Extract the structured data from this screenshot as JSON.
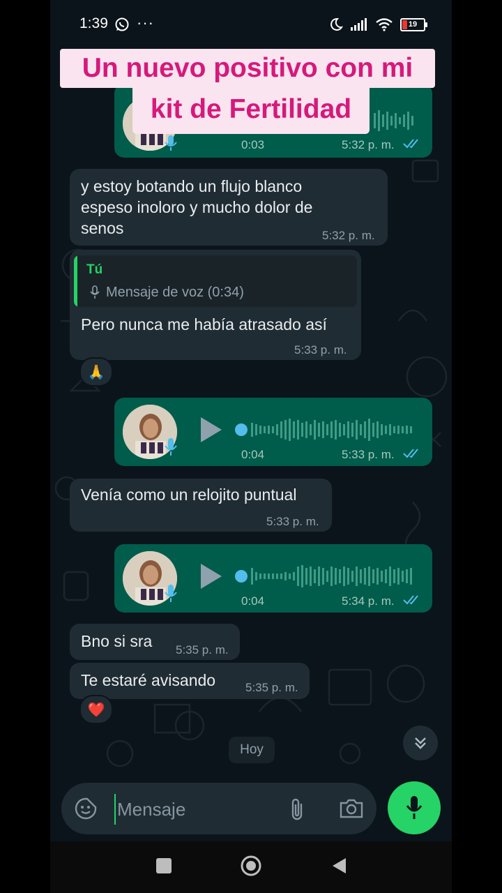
{
  "status_bar": {
    "time": "1:39",
    "more": "···",
    "battery": "19"
  },
  "overlay": {
    "line1": "Un nuevo positivo con mi",
    "line2": "kit de Fertilidad"
  },
  "messages": [
    {
      "type": "voice_out",
      "duration": "0:03",
      "time": "5:32 p. m."
    },
    {
      "type": "text_in",
      "text_line1": "y estoy botando un flujo blanco",
      "text_line2": "espeso inoloro y mucho dolor de",
      "text_line3": "senos",
      "time": "5:32 p. m."
    },
    {
      "type": "reply_in",
      "quote_author": "Tú",
      "quote_text": "Mensaje de voz (0:34)",
      "text": "Pero nunca me había atrasado así",
      "time": "5:33 p. m.",
      "reaction": "🙏"
    },
    {
      "type": "voice_out",
      "duration": "0:04",
      "time": "5:33 p. m."
    },
    {
      "type": "text_in",
      "text": "Venía como un relojito puntual",
      "time": "5:33 p. m."
    },
    {
      "type": "voice_out",
      "duration": "0:04",
      "time": "5:34 p. m."
    },
    {
      "type": "text_in",
      "text": "Bno si sra",
      "time": "5:35 p. m."
    },
    {
      "type": "text_in",
      "text": "Te estaré avisando",
      "time": "5:35 p. m.",
      "reaction": "❤️"
    }
  ],
  "date_chip": "Hoy",
  "composer": {
    "placeholder": "Mensaje"
  },
  "colors": {
    "incoming": "#202c33",
    "outgoing": "#005c4b",
    "accent": "#25d366",
    "read_ticks": "#53bdeb",
    "overlay_text": "#d6197b",
    "overlay_bg": "#f9e4ef"
  },
  "icons": [
    "whatsapp-icon",
    "moon-icon",
    "signal-icon",
    "wifi-icon",
    "battery-icon",
    "play-icon",
    "mic-icon",
    "double-check-icon",
    "sticker-icon",
    "attach-icon",
    "camera-icon",
    "chevron-double-down-icon",
    "recents-icon",
    "home-icon",
    "back-icon"
  ]
}
